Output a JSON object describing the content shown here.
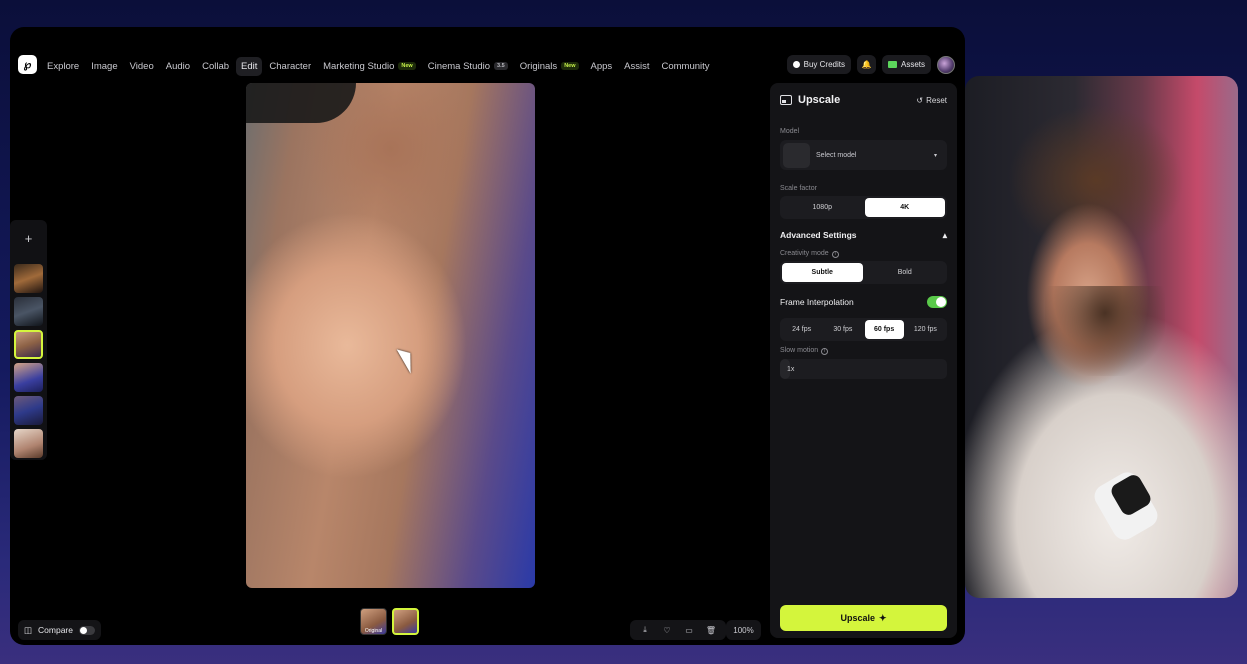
{
  "app": {
    "nav_items": [
      "Explore",
      "Image",
      "Video",
      "Audio",
      "Collab",
      "Edit",
      "Character",
      "Marketing Studio",
      "Cinema Studio",
      "Originals",
      "Apps",
      "Assist",
      "Community"
    ],
    "active_nav": "Edit",
    "tags": {
      "marketing": "New",
      "cinema": "3.5",
      "originals": "New"
    },
    "buy_credits": "Buy Credits",
    "assets": "Assets",
    "accent_color": "#d4f53c"
  },
  "panel": {
    "title": "Upscale",
    "reset": "Reset",
    "model_label": "Model",
    "model_value": "Select model",
    "scale_label": "Scale factor",
    "scale_options": [
      "1080p",
      "4K"
    ],
    "scale_selected": "4K",
    "advanced_label": "Advanced Settings",
    "creativity_label": "Creativity mode",
    "creativity_options": [
      "Subtle",
      "Bold"
    ],
    "creativity_selected": "Subtle",
    "frame_interp_label": "Frame Interpolation",
    "frame_interp_on": true,
    "fps_options": [
      "24 fps",
      "30 fps",
      "60 fps",
      "120 fps"
    ],
    "fps_selected": "60 fps",
    "slow_motion_label": "Slow motion",
    "slow_motion_value": "1x",
    "upscale_button": "Upscale"
  },
  "bottom": {
    "compare": "Compare",
    "compare_on": false,
    "thumb_label": "Original",
    "zoom": "100%"
  },
  "icons": {
    "logo": "app-logo-icon",
    "bell": "bell-icon",
    "download": "download-icon",
    "favorite": "heart-icon",
    "folder": "folder-icon",
    "delete": "trash-icon"
  }
}
